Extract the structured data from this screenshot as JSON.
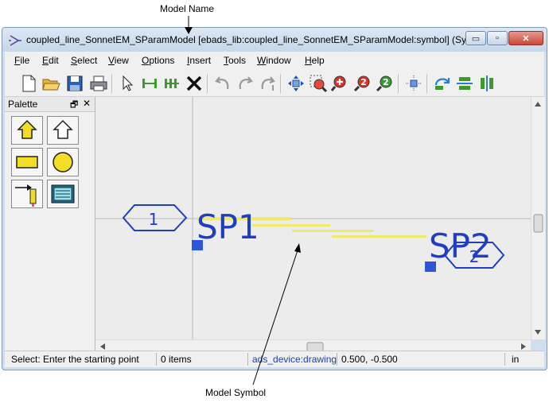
{
  "callouts": {
    "top": "Model Name",
    "bottom": "Model Symbol"
  },
  "window": {
    "title": "coupled_line_SonnetEM_SParamModel [ebads_lib:coupled_line_SonnetEM_SParamModel:symbol] (Sy...",
    "controls": {
      "minimize": "▭",
      "restore": "▫",
      "close": "✕"
    }
  },
  "menu": {
    "file": {
      "hot": "F",
      "rest": "ile"
    },
    "edit": {
      "hot": "E",
      "rest": "dit"
    },
    "select": {
      "hot": "S",
      "rest": "elect"
    },
    "view": {
      "hot": "V",
      "rest": "iew"
    },
    "options": {
      "hot": "O",
      "rest": "ptions"
    },
    "insert": {
      "hot": "I",
      "rest": "nsert"
    },
    "tools": {
      "hot": "T",
      "rest": "ools"
    },
    "window": {
      "hot": "W",
      "rest": "indow"
    },
    "help": {
      "hot": "H",
      "rest": "elp"
    }
  },
  "palette": {
    "title": "Palette",
    "float": "🗗",
    "close": "✕"
  },
  "canvas": {
    "port1_number": "1",
    "port2_number": "2",
    "label_sp1": "SP1",
    "label_sp2": "SP2",
    "accent_color": "#1f3fbf",
    "line_color": "#f0ea6a"
  },
  "status": {
    "prompt": "Select: Enter the starting point",
    "items": "0 items",
    "layer": "ads_device:drawing",
    "coords": "0.500, -0.500",
    "units": "in"
  },
  "icons": [
    "new-icon",
    "open-icon",
    "save-icon",
    "print-icon",
    "select-arrow-icon",
    "insert-wire-icon",
    "insert-pins-icon",
    "delete-icon",
    "undo-icon",
    "redo-icon",
    "repeat-icon",
    "move-icon",
    "zoom-area-icon",
    "zoom-in-icon",
    "zoom-x2-icon",
    "zoom-out-icon",
    "snap-icon",
    "rotate-icon",
    "mirror-x-icon",
    "mirror-y-icon"
  ]
}
